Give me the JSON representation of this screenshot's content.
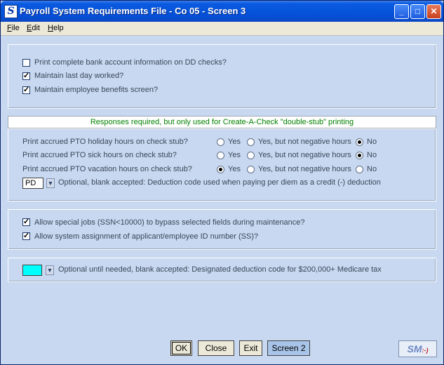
{
  "window": {
    "title": "Payroll System Requirements File - Co 05 - Screen 3",
    "app_icon": "S"
  },
  "menu": [
    {
      "label": "File",
      "accel": "F"
    },
    {
      "label": "Edit",
      "accel": "E"
    },
    {
      "label": "Help",
      "accel": "H"
    }
  ],
  "section1": [
    {
      "label": "Print complete bank account information on DD checks?",
      "checked": false
    },
    {
      "label": "Maintain last day worked?",
      "checked": true
    },
    {
      "label": "Maintain employee benefits screen?",
      "checked": true
    }
  ],
  "banner": "Responses required, but only used for Create-A-Check \"double-stub\" printing",
  "pto": {
    "options": [
      "Yes",
      "Yes, but not negative hours",
      "No"
    ],
    "rows": [
      {
        "label": "Print accrued PTO holiday hours on check stub?",
        "selected": 2
      },
      {
        "label": "Print accrued PTO sick hours on check stub?",
        "selected": 2
      },
      {
        "label": "Print accrued PTO vacation hours on check stub?",
        "selected": 0
      }
    ],
    "per_diem": {
      "value": "PD",
      "label": "Optional, blank accepted: Deduction code used when paying per diem as a credit (-) deduction"
    }
  },
  "section3": [
    {
      "label": "Allow special jobs (SSN<10000) to bypass selected fields during maintenance?",
      "checked": true
    },
    {
      "label": "Allow system assignment of applicant/employee ID number (SS)?",
      "checked": true
    }
  ],
  "medicare": {
    "value": "",
    "label": "Optional until needed, blank accepted: Designated deduction code for $200,000+ Medicare tax",
    "field_color": "#00ffff"
  },
  "buttons": {
    "ok": "OK",
    "close": "Close",
    "exit": "Exit",
    "screen2": "Screen 2"
  },
  "logo": {
    "text": "SM",
    "smile": ":-)"
  }
}
